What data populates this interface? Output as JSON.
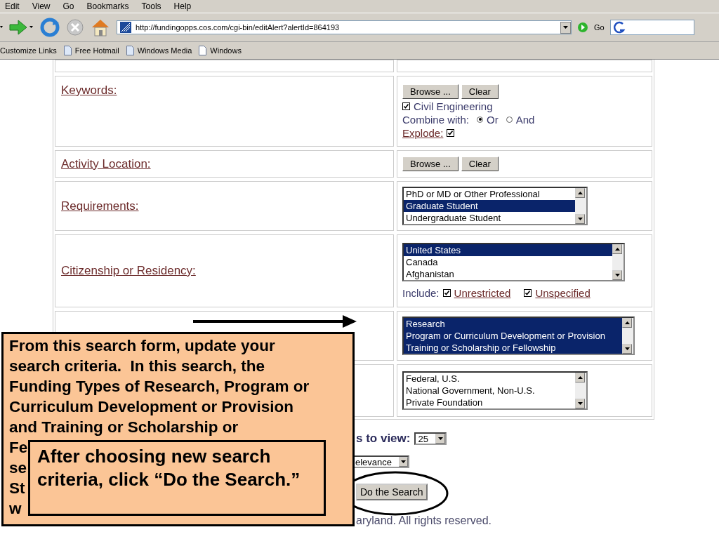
{
  "menu": [
    "Edit",
    "View",
    "Go",
    "Bookmarks",
    "Tools",
    "Help"
  ],
  "toolbar": {
    "address": "http://fundingopps.cos.com/cgi-bin/editAlert?alertId=864193",
    "go": "Go"
  },
  "links": [
    "Customize Links",
    "Free Hotmail",
    "Windows Media",
    "Windows"
  ],
  "form_rows": [
    {
      "kind": "keywords",
      "label": "Keywords:",
      "buttons": [
        "Browse ...",
        "Clear"
      ],
      "terms": [
        {
          "text": "Civil Engineering",
          "checked": true
        }
      ],
      "combine_label": "Combine with:",
      "combine_options": [
        {
          "text": "Or",
          "selected": true
        },
        {
          "text": "And",
          "selected": false
        }
      ],
      "explode": {
        "label": "Explode:",
        "checked": true
      }
    },
    {
      "kind": "browse",
      "label": "Activity Location:",
      "buttons": [
        "Browse ...",
        "Clear"
      ]
    },
    {
      "kind": "list",
      "label": "Requirements:",
      "options": [
        {
          "text": "PhD or MD or Other Professional",
          "selected": false
        },
        {
          "text": "Graduate Student",
          "selected": true
        },
        {
          "text": "Undergraduate Student",
          "selected": false
        }
      ]
    },
    {
      "kind": "list",
      "label": "Citizenship or Residency:",
      "options": [
        {
          "text": "United States",
          "selected": true
        },
        {
          "text": "Canada",
          "selected": false
        },
        {
          "text": "Afghanistan",
          "selected": false
        }
      ],
      "include_label": "Include:",
      "include": [
        {
          "text": "Unrestricted",
          "checked": true
        },
        {
          "text": "Unspecified",
          "checked": true
        }
      ]
    },
    {
      "kind": "list",
      "options": [
        {
          "text": "Research",
          "selected": true
        },
        {
          "text": "Program or Curriculum Development or Provision",
          "selected": true
        },
        {
          "text": "Training or Scholarship or Fellowship",
          "selected": true
        }
      ]
    },
    {
      "kind": "list",
      "options": [
        {
          "text": "Federal, U.S.",
          "selected": false
        },
        {
          "text": "National Government, Non-U.S.",
          "selected": false
        },
        {
          "text": "Private Foundation",
          "selected": false
        }
      ]
    }
  ],
  "results_label": "s to view:",
  "results_value": "25",
  "sort_value": "elevance",
  "search_button": "Do the Search",
  "footer": "aryland. All rights reserved.",
  "callouts": [
    {
      "text": "From this search form, update your\nsearch criteria.  In this search, the\nFunding Types of Research, Program or\nCurriculum Development or Provision\nand Training or Scholarship or",
      "fragments": [
        "Fe",
        "se",
        "St",
        "w"
      ]
    },
    {
      "text": "After choosing new search criteria, click “Do the Search.”"
    }
  ]
}
